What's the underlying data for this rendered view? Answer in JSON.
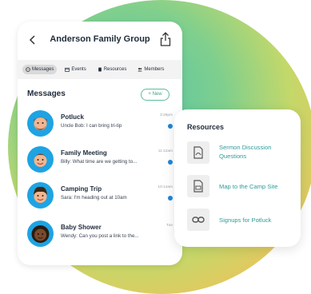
{
  "header": {
    "title": "Anderson Family Group"
  },
  "tabs": [
    {
      "label": "Messages",
      "icon": "chat-icon"
    },
    {
      "label": "Events",
      "icon": "calendar-icon"
    },
    {
      "label": "Resources",
      "icon": "document-icon"
    },
    {
      "label": "Members",
      "icon": "people-icon"
    }
  ],
  "messages": {
    "title": "Messages",
    "new_label": "+ New",
    "items": [
      {
        "title": "Potluck",
        "preview": "Uncle Bob: I can bring tri-tip",
        "time": "3:29pm",
        "unread": true
      },
      {
        "title": "Family Meeting",
        "preview": "Billy: What time are we getting to...",
        "time": "11:12am",
        "unread": true
      },
      {
        "title": "Camping Trip",
        "preview": "Sara: I'm heading out at 10am",
        "time": "10:14am",
        "unread": true
      },
      {
        "title": "Baby Shower",
        "preview": "Wendy: Can you post a link to the...",
        "time": "Tue",
        "unread": false
      }
    ]
  },
  "resources": {
    "title": "Resources",
    "items": [
      {
        "label": "Sermon Discussion Questions",
        "icon": "pdf-icon"
      },
      {
        "label": "Map to the Camp Site",
        "icon": "image-file-icon"
      },
      {
        "label": "Signups for Potluck",
        "icon": "link-icon"
      }
    ]
  },
  "colors": {
    "accent": "#2f9c9a",
    "dot": "#1f86d8",
    "avatar_bg": "#1ea3e3"
  }
}
